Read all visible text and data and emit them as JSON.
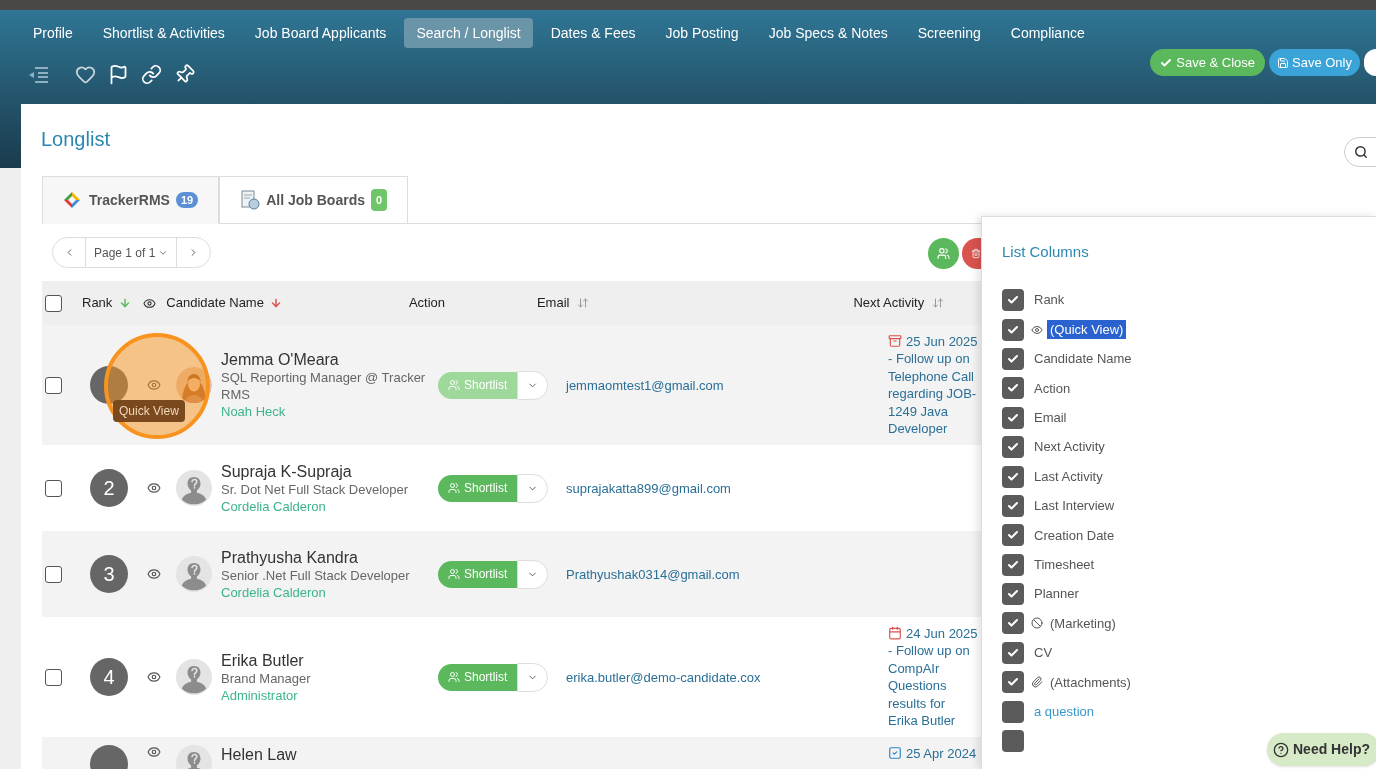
{
  "nav_tabs": [
    {
      "label": "Profile",
      "selected": false
    },
    {
      "label": "Shortlist & Activities",
      "selected": false
    },
    {
      "label": "Job Board Applicants",
      "selected": false
    },
    {
      "label": "Search / Longlist",
      "selected": true
    },
    {
      "label": "Dates & Fees",
      "selected": false
    },
    {
      "label": "Job Posting",
      "selected": false
    },
    {
      "label": "Job Specs & Notes",
      "selected": false
    },
    {
      "label": "Screening",
      "selected": false
    },
    {
      "label": "Compliance",
      "selected": false
    }
  ],
  "buttons": [
    {
      "kind": "save_close",
      "label": "Save & Close"
    },
    {
      "kind": "save",
      "label": "Save Only"
    }
  ],
  "title": "Longlist",
  "source_tabs": [
    {
      "kind": "tracker",
      "label": "TrackerRMS",
      "count": "19",
      "selected": true
    },
    {
      "kind": "boards",
      "label": "All Job Boards",
      "count": "0",
      "selected": false
    }
  ],
  "pager": {
    "label": "Page 1 of 1"
  },
  "select_all": {
    "checked": false
  },
  "columns": {
    "rank": "Rank",
    "name": "Candidate Name",
    "action": "Action",
    "email": "Email",
    "next": "Next Activity"
  },
  "rows": [
    {
      "checked": false,
      "photo": true,
      "name": "Jemma O'Meara",
      "title": "SQL Reporting Manager @ Tracker RMS",
      "owner": "Noah Heck",
      "action": "Shortlist",
      "disabled": true,
      "email": "jemmaomtest1@gmail.com",
      "activity": {
        "kind": "archive",
        "date": "25 Jun 2025",
        "text": "- Follow up on Telephone Call regarding JOB-1249 Java Developer"
      }
    },
    {
      "checked": false,
      "rank": "2",
      "photo": false,
      "name": "Supraja K-Supraja",
      "title": "Sr. Dot Net Full Stack Developer",
      "owner": "Cordelia Calderon",
      "action": "Shortlist",
      "disabled": false,
      "email": "suprajakatta899@gmail.com"
    },
    {
      "checked": false,
      "rank": "3",
      "photo": false,
      "name": "Prathyusha Kandra",
      "title": "Senior .Net Full Stack Developer",
      "owner": "Cordelia Calderon",
      "action": "Shortlist",
      "disabled": false,
      "email": "Prathyushak0314@gmail.com"
    },
    {
      "checked": false,
      "rank": "4",
      "photo": false,
      "name": "Erika Butler",
      "title": "Brand Manager",
      "owner": "Administrator",
      "action": "Shortlist",
      "disabled": false,
      "email": "erika.butler@demo-candidate.cox",
      "activity": {
        "kind": "calendar",
        "date": "24 Jun 2025",
        "text": "- Follow up on CompAIr Questions results for Erika Butler"
      }
    },
    {
      "photo": false,
      "name": "Helen Law",
      "activity": {
        "kind": "task",
        "date": "25 Apr 2024"
      }
    }
  ],
  "tooltip": "Quick View",
  "list_columns": {
    "title": "List Columns",
    "items": [
      {
        "kind": "plain",
        "label": "Rank",
        "checked": true,
        "selected": false
      },
      {
        "kind": "eye",
        "label": "(Quick View)",
        "checked": true,
        "selected": true
      },
      {
        "kind": "plain",
        "label": "Candidate Name",
        "checked": true,
        "selected": false
      },
      {
        "kind": "plain",
        "label": "Action",
        "checked": true,
        "selected": false
      },
      {
        "kind": "plain",
        "label": "Email",
        "checked": true,
        "selected": false
      },
      {
        "kind": "plain",
        "label": "Next Activity",
        "checked": true,
        "selected": false
      },
      {
        "kind": "plain",
        "label": "Last Activity",
        "checked": true,
        "selected": false
      },
      {
        "kind": "plain",
        "label": "Last Interview",
        "checked": true,
        "selected": false
      },
      {
        "kind": "plain",
        "label": "Creation Date",
        "checked": true,
        "selected": false
      },
      {
        "kind": "plain",
        "label": "Timesheet",
        "checked": true,
        "selected": false
      },
      {
        "kind": "plain",
        "label": "Planner",
        "checked": true,
        "selected": false
      },
      {
        "kind": "ban",
        "label": "(Marketing)",
        "checked": true,
        "selected": false
      },
      {
        "kind": "plain",
        "label": "CV",
        "checked": true,
        "selected": false
      },
      {
        "kind": "clip",
        "label": "(Attachments)",
        "checked": true,
        "selected": false
      },
      {
        "kind": "link",
        "label": "a question",
        "checked": false,
        "selected": false
      },
      {
        "kind": "plain",
        "checked": false
      }
    ]
  },
  "help": {
    "label": "Need Help?"
  }
}
